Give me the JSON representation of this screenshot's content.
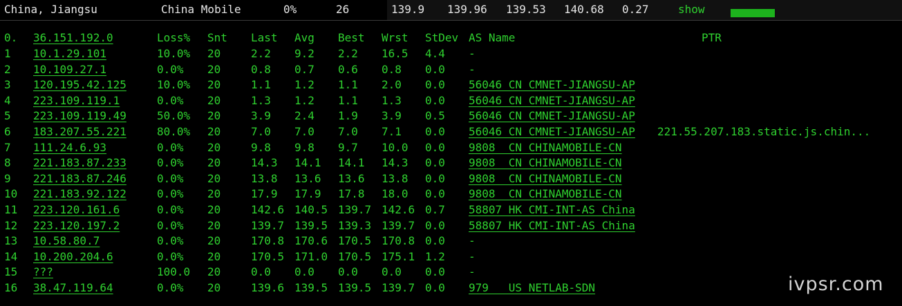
{
  "header": {
    "location": "China, Jiangsu",
    "isp": "China Mobile",
    "loss": "0%",
    "count": "26",
    "v1": "139.9",
    "v2": "139.96",
    "v3": "139.53",
    "v4": "140.68",
    "v5": "0.27",
    "action": "show"
  },
  "columns": {
    "idx": "0.",
    "host": "36.151.192.0",
    "loss": "Loss%",
    "snt": "Snt",
    "last": "Last",
    "avg": "Avg",
    "best": "Best",
    "wrst": "Wrst",
    "stdev": "StDev",
    "asname": "AS Name",
    "ptr": "PTR"
  },
  "hops": [
    {
      "n": "1",
      "host": "10.1.29.101",
      "loss": "10.0%",
      "snt": "20",
      "last": "2.2",
      "avg": "9.2",
      "best": "2.2",
      "wrst": "16.5",
      "stdev": "4.4",
      "asname": "-",
      "ptr": ""
    },
    {
      "n": "2",
      "host": "10.109.27.1",
      "loss": "0.0%",
      "snt": "20",
      "last": "0.8",
      "avg": "0.7",
      "best": "0.6",
      "wrst": "0.8",
      "stdev": "0.0",
      "asname": "-",
      "ptr": ""
    },
    {
      "n": "3",
      "host": "120.195.42.125",
      "loss": "10.0%",
      "snt": "20",
      "last": "1.1",
      "avg": "1.2",
      "best": "1.1",
      "wrst": "2.0",
      "stdev": "0.0",
      "asname": "56046 CN CMNET-JIANGSU-AP",
      "ptr": ""
    },
    {
      "n": "4",
      "host": "223.109.119.1",
      "loss": "0.0%",
      "snt": "20",
      "last": "1.3",
      "avg": "1.2",
      "best": "1.1",
      "wrst": "1.3",
      "stdev": "0.0",
      "asname": "56046 CN CMNET-JIANGSU-AP",
      "ptr": ""
    },
    {
      "n": "5",
      "host": "223.109.119.49",
      "loss": "50.0%",
      "snt": "20",
      "last": "3.9",
      "avg": "2.4",
      "best": "1.9",
      "wrst": "3.9",
      "stdev": "0.5",
      "asname": "56046 CN CMNET-JIANGSU-AP",
      "ptr": ""
    },
    {
      "n": "6",
      "host": "183.207.55.221",
      "loss": "80.0%",
      "snt": "20",
      "last": "7.0",
      "avg": "7.0",
      "best": "7.0",
      "wrst": "7.1",
      "stdev": "0.0",
      "asname": "56046 CN CMNET-JIANGSU-AP",
      "ptr": "221.55.207.183.static.js.chin..."
    },
    {
      "n": "7",
      "host": "111.24.6.93",
      "loss": "0.0%",
      "snt": "20",
      "last": "9.8",
      "avg": "9.8",
      "best": "9.7",
      "wrst": "10.0",
      "stdev": "0.0",
      "asname": "9808  CN CHINAMOBILE-CN",
      "ptr": ""
    },
    {
      "n": "8",
      "host": "221.183.87.233",
      "loss": "0.0%",
      "snt": "20",
      "last": "14.3",
      "avg": "14.1",
      "best": "14.1",
      "wrst": "14.3",
      "stdev": "0.0",
      "asname": "9808  CN CHINAMOBILE-CN",
      "ptr": ""
    },
    {
      "n": "9",
      "host": "221.183.87.246",
      "loss": "0.0%",
      "snt": "20",
      "last": "13.8",
      "avg": "13.6",
      "best": "13.6",
      "wrst": "13.8",
      "stdev": "0.0",
      "asname": "9808  CN CHINAMOBILE-CN",
      "ptr": ""
    },
    {
      "n": "10",
      "host": "221.183.92.122",
      "loss": "0.0%",
      "snt": "20",
      "last": "17.9",
      "avg": "17.9",
      "best": "17.8",
      "wrst": "18.0",
      "stdev": "0.0",
      "asname": "9808  CN CHINAMOBILE-CN",
      "ptr": ""
    },
    {
      "n": "11",
      "host": "223.120.161.6",
      "loss": "0.0%",
      "snt": "20",
      "last": "142.6",
      "avg": "140.5",
      "best": "139.7",
      "wrst": "142.6",
      "stdev": "0.7",
      "asname": "58807 HK CMI-INT-AS China",
      "ptr": ""
    },
    {
      "n": "12",
      "host": "223.120.197.2",
      "loss": "0.0%",
      "snt": "20",
      "last": "139.7",
      "avg": "139.5",
      "best": "139.3",
      "wrst": "139.7",
      "stdev": "0.0",
      "asname": "58807 HK CMI-INT-AS China",
      "ptr": ""
    },
    {
      "n": "13",
      "host": "10.58.80.7",
      "loss": "0.0%",
      "snt": "20",
      "last": "170.8",
      "avg": "170.6",
      "best": "170.5",
      "wrst": "170.8",
      "stdev": "0.0",
      "asname": "-",
      "ptr": ""
    },
    {
      "n": "14",
      "host": "10.200.204.6",
      "loss": "0.0%",
      "snt": "20",
      "last": "170.5",
      "avg": "171.0",
      "best": "170.5",
      "wrst": "175.1",
      "stdev": "1.2",
      "asname": "-",
      "ptr": ""
    },
    {
      "n": "15",
      "host": "???",
      "loss": "100.0",
      "snt": "20",
      "last": "0.0",
      "avg": "0.0",
      "best": "0.0",
      "wrst": "0.0",
      "stdev": "0.0",
      "asname": "-",
      "ptr": ""
    },
    {
      "n": "16",
      "host": "38.47.119.64",
      "loss": "0.0%",
      "snt": "20",
      "last": "139.6",
      "avg": "139.5",
      "best": "139.5",
      "wrst": "139.7",
      "stdev": "0.0",
      "asname": "979   US NETLAB-SDN",
      "ptr": ""
    }
  ],
  "watermark": "ivpsr.com"
}
